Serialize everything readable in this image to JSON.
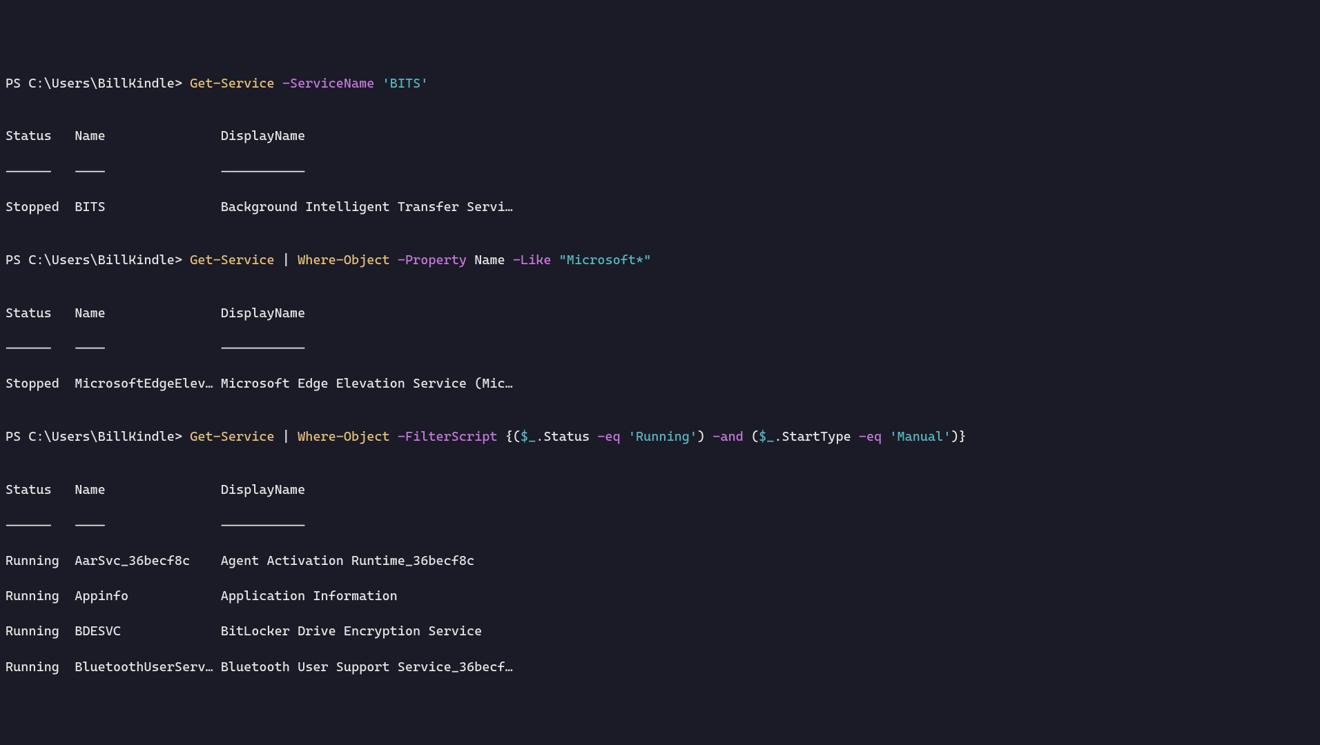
{
  "prompt": {
    "ps": "PS ",
    "path": "C:\\Users\\BillKindle",
    "gt": "> "
  },
  "cmd1": {
    "cmdlet": "Get-Service",
    "param": "-ServiceName",
    "value": "'BITS'"
  },
  "cmd2": {
    "cmdlet1": "Get-Service",
    "pipe": " | ",
    "cmdlet2": "Where-Object",
    "param1": "-Property",
    "val1": "Name",
    "param2": "-Like",
    "val2": "\"Microsoft*\""
  },
  "cmd3": {
    "cmdlet1": "Get-Service",
    "pipe": " | ",
    "cmdlet2": "Where-Object",
    "param": "-FilterScript",
    "brace_open": "{",
    "p1": "(",
    "dollar1": "$_",
    "dot1": ".Status ",
    "op1": "-eq",
    "str1": " 'Running'",
    "p1c": ")",
    "and": " -and ",
    "p2": "(",
    "dollar2": "$_",
    "dot2": ".StartType ",
    "op2": "-eq",
    "str2": " 'Manual'",
    "p2c": ")",
    "brace_close": "}"
  },
  "headers": {
    "status": "Status",
    "name": "Name",
    "displayname": "DisplayName"
  },
  "dashes": {
    "status": "------",
    "name": "----",
    "displayname": "-----------"
  },
  "out1": {
    "row1": {
      "status": "Stopped",
      "name": "BITS",
      "displayname": "Background Intelligent Transfer Servi…"
    }
  },
  "out2": {
    "row1": {
      "status": "Stopped",
      "name": "MicrosoftEdgeElev…",
      "displayname": "Microsoft Edge Elevation Service (Mic…"
    }
  },
  "out3": {
    "row1": {
      "status": "Running",
      "name": "AarSvc_36becf8c",
      "displayname": "Agent Activation Runtime_36becf8c"
    },
    "row2": {
      "status": "Running",
      "name": "Appinfo",
      "displayname": "Application Information"
    },
    "row3": {
      "status": "Running",
      "name": "BDESVC",
      "displayname": "BitLocker Drive Encryption Service"
    },
    "row4": {
      "status": "Running",
      "name": "BluetoothUserServ…",
      "displayname": "Bluetooth User Support Service_36becf…"
    }
  },
  "cols": {
    "status_w": 9,
    "name_w": 19
  }
}
